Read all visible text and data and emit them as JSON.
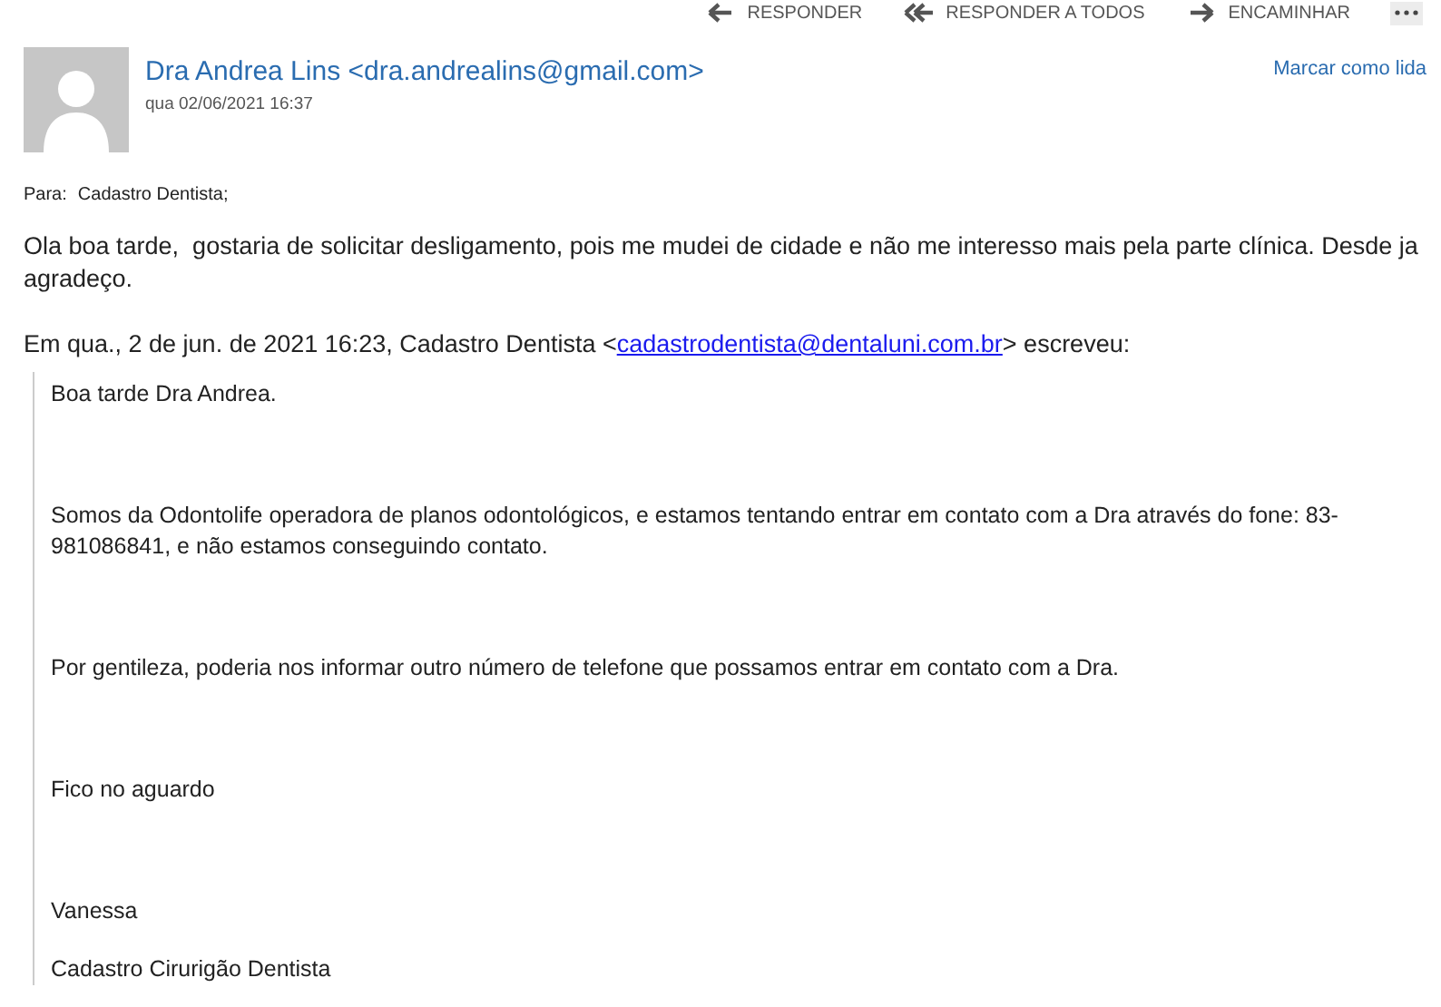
{
  "toolbar": {
    "actions": [
      {
        "kind": "reply",
        "label": "RESPONDER"
      },
      {
        "kind": "reply_all",
        "label": "RESPONDER A TODOS"
      },
      {
        "kind": "forward",
        "label": "ENCAMINHAR"
      }
    ]
  },
  "message": {
    "sender": "Dra Andrea Lins <dra.andrealins@gmail.com>",
    "date": "qua 02/06/2021 16:37",
    "mark_read": "Marcar como lida",
    "to_label": "Para:",
    "to": "Cadastro Dentista;",
    "body": [
      "Ola boa tarde,  gostaria de solicitar desligamento, pois me mudei de cidade e não me interesso mais pela parte clínica. Desde ja agradeço."
    ],
    "quote_header": {
      "before": "Em qua., 2 de jun. de 2021 16:23, Cadastro Dentista <",
      "link": "cadastrodentista@dentaluni.com.br",
      "after": "> escreveu:"
    },
    "quoted": [
      "Boa tarde Dra Andrea.",
      "Somos da Odontolife operadora de planos odontológicos, e estamos tentando entrar em contato com a Dra através do fone: 83-981086841, e não estamos conseguindo contato.",
      "Por gentileza, poderia nos informar outro número de telefone que possamos entrar em contato com a Dra.",
      "Fico no aguardo",
      "Vanessa",
      "Cadastro Cirurigão Dentista"
    ]
  }
}
